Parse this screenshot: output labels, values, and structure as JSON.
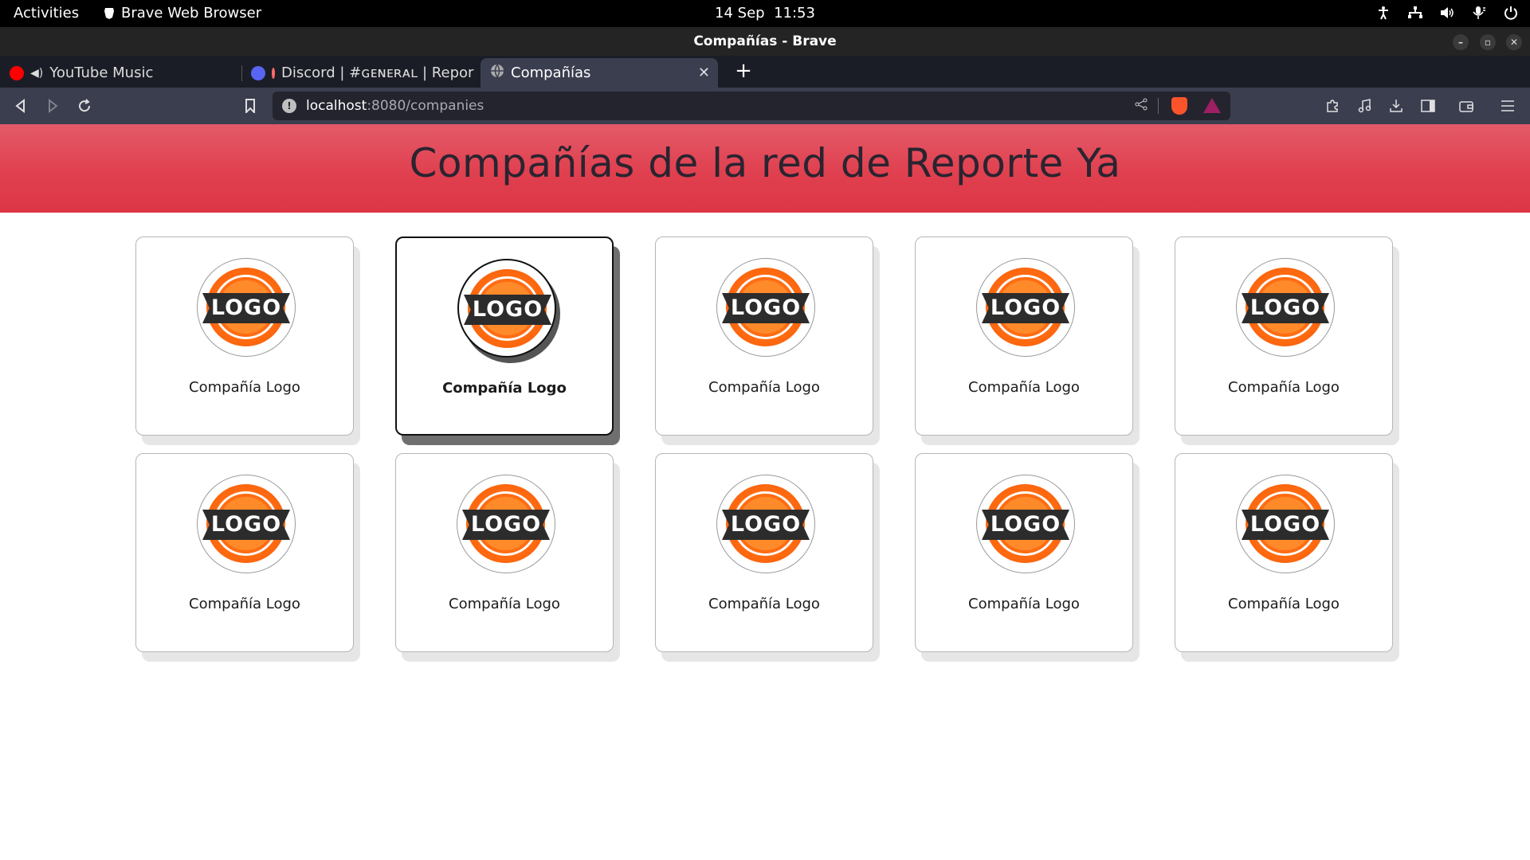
{
  "system_bar": {
    "activities": "Activities",
    "app_name": "Brave Web Browser",
    "date": "14 Sep",
    "time": "11:53"
  },
  "window": {
    "title": "Compañías - Brave"
  },
  "tabs": [
    {
      "label": "YouTube Music",
      "favicon_color": "#ff0000",
      "audio_icon": "speaker-icon"
    },
    {
      "label": "Discord | #ɢᴇɴᴇʀᴀʟ | Repor",
      "favicon_color": "#5865f2",
      "recording_icon": "record-icon"
    },
    {
      "label": "Compañías",
      "favicon": "globe-icon",
      "active": true
    }
  ],
  "address_bar": {
    "host": "localhost",
    "path": ":8080/companies"
  },
  "page": {
    "heading": "Compañías de la red de Reporte Ya",
    "companies": [
      {
        "name": "Compañía Logo",
        "logo_text": "LOGO"
      },
      {
        "name": "Compañía Logo",
        "logo_text": "LOGO",
        "hovered": true
      },
      {
        "name": "Compañía Logo",
        "logo_text": "LOGO"
      },
      {
        "name": "Compañía Logo",
        "logo_text": "LOGO"
      },
      {
        "name": "Compañía Logo",
        "logo_text": "LOGO"
      },
      {
        "name": "Compañía Logo",
        "logo_text": "LOGO"
      },
      {
        "name": "Compañía Logo",
        "logo_text": "LOGO"
      },
      {
        "name": "Compañía Logo",
        "logo_text": "LOGO"
      },
      {
        "name": "Compañía Logo",
        "logo_text": "LOGO"
      },
      {
        "name": "Compañía Logo",
        "logo_text": "LOGO"
      }
    ]
  },
  "colors": {
    "hero_red": "#dc3546",
    "logo_orange": "#ff6a10",
    "logo_banner": "#2c2c2c"
  }
}
